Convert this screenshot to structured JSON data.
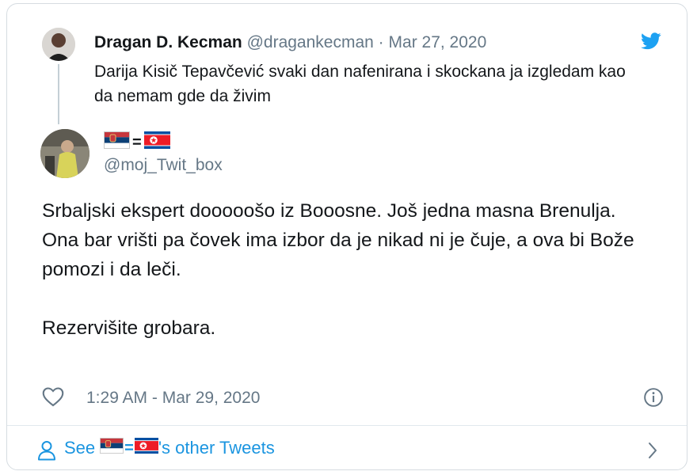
{
  "parent_tweet": {
    "name": "Dragan D. Kecman",
    "handle": "@dragankecman",
    "separator": "·",
    "date": "Mar 27, 2020",
    "text": "Darija Kisič Tepavčević svaki dan nafenirana i skockana ja izgledam kao da nemam gde da živim"
  },
  "main_tweet": {
    "name_separator": "=",
    "handle": "@moj_Twit_box",
    "paragraphs": [
      "Srbaljski ekspert dooooošo iz Booosne. Još jedna masna Brenulja.",
      "Ona bar vrišti pa čovek ima izbor da je nikad ni je čuje, a ova bi Bože pomozi i da leči.",
      "",
      "Rezervišite grobara."
    ],
    "timestamp": "1:29 AM - Mar 29, 2020"
  },
  "footer": {
    "prefix": "See",
    "separator": "=",
    "suffix": "'s other Tweets"
  },
  "icons": {
    "brand": "twitter-bird-icon",
    "like": "heart-icon",
    "info": "info-icon",
    "person": "person-icon",
    "chevron": "chevron-right-icon",
    "flag_1": "serbia-flag-icon",
    "flag_2": "north-korea-flag-icon"
  },
  "colors": {
    "link": "#1b95e0",
    "muted": "#657786",
    "text": "#14171a",
    "border": "#d6dce1"
  }
}
